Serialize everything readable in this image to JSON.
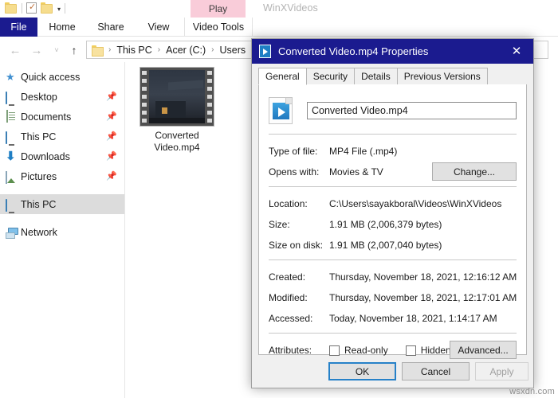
{
  "explorer": {
    "window_title": "WinXVideos",
    "quick_access_toolbar": [
      {
        "name": "folder-icon",
        "label": ""
      },
      {
        "name": "properties-icon",
        "label": ""
      },
      {
        "name": "new-folder-icon",
        "label": ""
      },
      {
        "name": "customize-caret-icon",
        "label": "▾"
      }
    ],
    "contextual_tab": "Play",
    "ribbon_tabs": [
      {
        "label": "File",
        "active": true
      },
      {
        "label": "Home",
        "active": false
      },
      {
        "label": "Share",
        "active": false
      },
      {
        "label": "View",
        "active": false
      },
      {
        "label": "Video Tools",
        "active": false
      }
    ],
    "nav": {
      "back": "←",
      "forward": "→",
      "recent": "˅",
      "up": "↑"
    },
    "breadcrumb": [
      "This PC",
      "Acer (C:)",
      "Users"
    ],
    "breadcrumb_separator": "›",
    "sidebar": [
      {
        "label": "Quick access",
        "icon": "star-icon",
        "pinned": false,
        "selected": false,
        "header": true
      },
      {
        "label": "Desktop",
        "icon": "desktop-icon",
        "pinned": true,
        "selected": false
      },
      {
        "label": "Documents",
        "icon": "documents-icon",
        "pinned": true,
        "selected": false
      },
      {
        "label": "This PC",
        "icon": "this-pc-icon",
        "pinned": true,
        "selected": false
      },
      {
        "label": "Downloads",
        "icon": "downloads-icon",
        "pinned": true,
        "selected": false
      },
      {
        "label": "Pictures",
        "icon": "pictures-icon",
        "pinned": true,
        "selected": false
      },
      {
        "label": "This PC",
        "icon": "this-pc-icon",
        "pinned": false,
        "selected": true
      },
      {
        "label": "Network",
        "icon": "network-icon",
        "pinned": false,
        "selected": false
      }
    ],
    "file": {
      "name_line1": "Converted",
      "name_line2": "Video.mp4"
    }
  },
  "dialog": {
    "title": "Converted Video.mp4 Properties",
    "title_icon": "video-file-icon",
    "close_label": "✕",
    "tabs": [
      {
        "label": "General",
        "active": true
      },
      {
        "label": "Security",
        "active": false
      },
      {
        "label": "Details",
        "active": false
      },
      {
        "label": "Previous Versions",
        "active": false
      }
    ],
    "filename_value": "Converted Video.mp4",
    "filename_placeholder": "File name",
    "rows": [
      {
        "key": "Type of file:",
        "value": "MP4 File (.mp4)"
      },
      {
        "key": "Opens with:",
        "value": "Movies & TV"
      },
      {
        "key": "Location:",
        "value": "C:\\Users\\sayakboral\\Videos\\WinXVideos"
      },
      {
        "key": "Size:",
        "value": "1.91 MB (2,006,379 bytes)"
      },
      {
        "key": "Size on disk:",
        "value": "1.91 MB (2,007,040 bytes)"
      },
      {
        "key": "Created:",
        "value": "Thursday, November 18, 2021, 12:16:12 AM"
      },
      {
        "key": "Modified:",
        "value": "Thursday, November 18, 2021, 12:17:01 AM"
      },
      {
        "key": "Accessed:",
        "value": "Today, November 18, 2021, 1:14:17 AM"
      }
    ],
    "change_button": "Change...",
    "attributes_label": "Attributes:",
    "attributes": [
      {
        "label": "Read-only",
        "checked": false
      },
      {
        "label": "Hidden",
        "checked": false
      }
    ],
    "advanced_button": "Advanced...",
    "footer_buttons": [
      {
        "label": "OK",
        "state": "default"
      },
      {
        "label": "Cancel",
        "state": "normal"
      },
      {
        "label": "Apply",
        "state": "disabled"
      }
    ],
    "accent_color": "#1b1b8f",
    "focus_color": "#2681c8"
  },
  "watermark": "wsxdn.com"
}
